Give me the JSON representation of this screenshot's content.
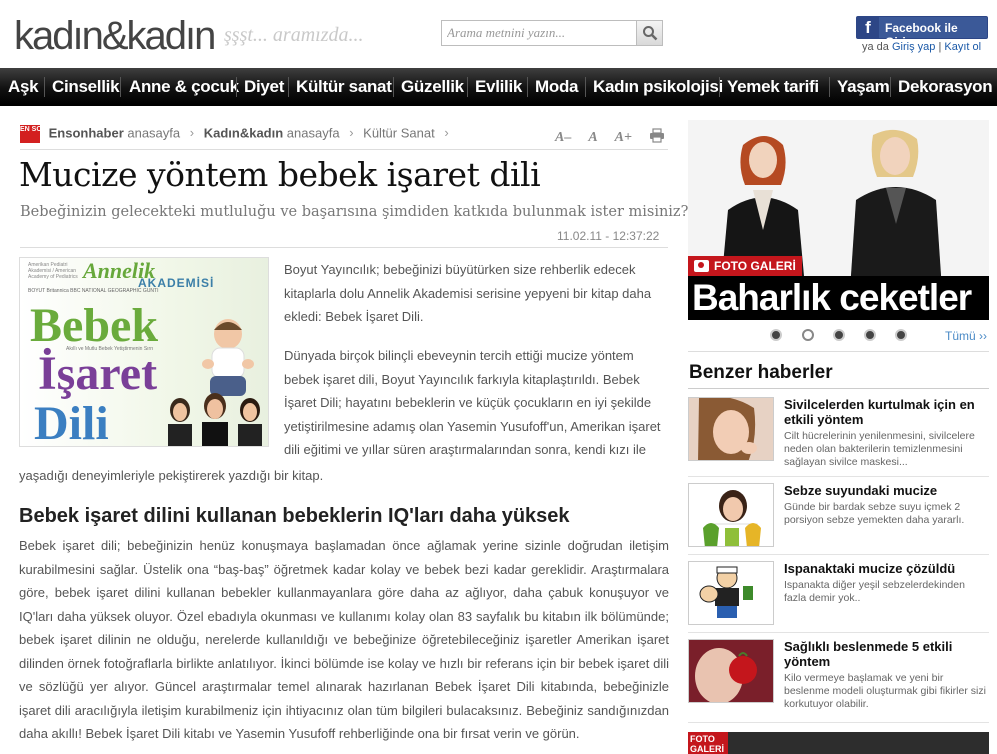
{
  "header": {
    "logo": "kadın&kadın",
    "tagline": "şşşt... aramızda...",
    "search_placeholder": "Arama metnini yazın...",
    "facebook_label": "Facebook ile Giriş",
    "login_prefix": "ya da",
    "login_link": "Giriş yap",
    "separator": "|",
    "register_link": "Kayıt ol"
  },
  "nav": {
    "items": [
      "Aşk",
      "Cinsellik",
      "Anne & çocuk",
      "Diyet",
      "Kültür sanat",
      "Güzellik",
      "Evlilik",
      "Moda",
      "Kadın psikolojisi",
      "Yemek tarifi",
      "Yaşam",
      "Dekorasyon"
    ]
  },
  "breadcrumb": {
    "badge": "EN SON HABER",
    "items": [
      {
        "bold": "Ensonhaber",
        "rest": " anasayfa"
      },
      {
        "bold": "Kadın&kadın",
        "rest": " anasayfa"
      },
      {
        "bold": "",
        "rest": "Kültür Sanat"
      }
    ],
    "tools": [
      "A–",
      "A",
      "A+"
    ]
  },
  "article": {
    "title": "Mucize yöntem bebek işaret dili",
    "subtitle": "Bebeğinizin gelecekteki mutluluğu ve başarısına şimdiden katkıda bulunmak ister misiniz?",
    "date": "11.02.11 - 12:37:22",
    "cover": {
      "publisher_note": "Amerikan Pediatri Akademisi / American Academy of Pediatrics",
      "brand": "Annelik",
      "series": "AKADEMİSİ",
      "logos": "BOYUT   Britannica   BBC   NATIONAL GEOGRAPHIC   GUNTI",
      "line1": "Bebek",
      "line2": "İşaret",
      "line3": "Dili",
      "tagline": "Akıllı ve Mutlu Bebek Yetiştirmenin Sırrı"
    },
    "p1": "Boyut Yayıncılık; bebeğinizi büyütürken size rehberlik edecek kitaplarla dolu Annelik Akademisi serisine yepyeni bir kitap daha ekledi: Bebek İşaret Dili.",
    "p2": "Dünyada birçok bilinçli ebeveynin tercih ettiği mucize yöntem bebek işaret dili, Boyut Yayıncılık farkıyla kitaplaştırıldı. Bebek İşaret Dili; hayatını bebeklerin ve küçük çocukların en iyi şekilde yetiştirilmesine adamış olan Yasemin Yusufoff'un, Amerikan işaret dili eğitimi ve yıllar süren araştırmalarından sonra, kendi kızı ile",
    "p2b": "yaşadığı deneyimleriyle pekiştirerek yazdığı bir kitap.",
    "heading": "Bebek işaret dilini kullanan bebeklerin IQ'ları daha yüksek",
    "p3": "Bebek işaret dili; bebeğinizin henüz konuşmaya başlamadan önce ağlamak yerine sizinle doğrudan iletişim kurabilmesini sağlar. Üstelik ona “baş-baş” öğretmek kadar kolay ve bebek bezi kadar gereklidir. Araştırmalara göre, bebek işaret dilini kullanan bebekler kullanmayanlara göre daha az ağlıyor, daha çabuk konuşuyor ve IQ'ları daha yüksek oluyor. Özel ebadıyla okunması ve kullanımı kolay olan 83 sayfalık bu kitabın ilk bölümünde; bebek işaret dilinin ne olduğu, nerelerde kullanıldığı ve bebeğinize öğretebileceğiniz işaretler Amerikan işaret dilinden örnek fotoğraflarla birlikte anlatılıyor. İkinci bölümde ise kolay ve hızlı bir referans için bir bebek işaret dili ve sözlüğü yer alıyor. Güncel araştırmalar temel alınarak hazırlanan Bebek İşaret Dili kitabında, bebeğinizle işaret dili aracılığıyla iletişim kurabilmeniz için ihtiyacınız olan tüm bilgileri bulacaksınız. Bebeğiniz sandığınızdan daha akıllı! Bebek İşaret Dili kitabı ve Yasemin Yusufoff rehberliğinde ona bir fırsat verin ve görün."
  },
  "sidebar": {
    "gallery_tag": "FOTO GALERİ",
    "gallery_caption": "Baharlık ceketler",
    "all_link": "Tümü ››",
    "related_title": "Benzer haberler",
    "items": [
      {
        "title": "Sivilcelerden kurtulmak için en etkili yöntem",
        "desc": "Cilt hücrelerinin yenilenmesini, sivilcelere neden olan bakterilerin temizlenmesini sağlayan sivilce maskesi..."
      },
      {
        "title": "Sebze suyundaki mucize",
        "desc": "Günde bir bardak sebze suyu içmek 2 porsiyon sebze yemekten daha yararlı."
      },
      {
        "title": "Ispanaktaki mucize çözüldü",
        "desc": "Ispanakta diğer yeşil sebzelerdekinden fazla demir yok.."
      },
      {
        "title": "Sağlıklı beslenmede 5 etkili yöntem",
        "desc": "Kilo vermeye başlamak ve yeni bir beslenme modeli oluşturmak gibi fikirler sizi korkutuyor olabilir."
      }
    ],
    "bottom_tag": "FOTO GALERİ"
  },
  "colors": {
    "nav_bg": "#000000",
    "facebook": "#3b5998",
    "gallery_red": "#c4161c",
    "link_blue": "#1c5aa8",
    "badge_red": "#d32020"
  }
}
